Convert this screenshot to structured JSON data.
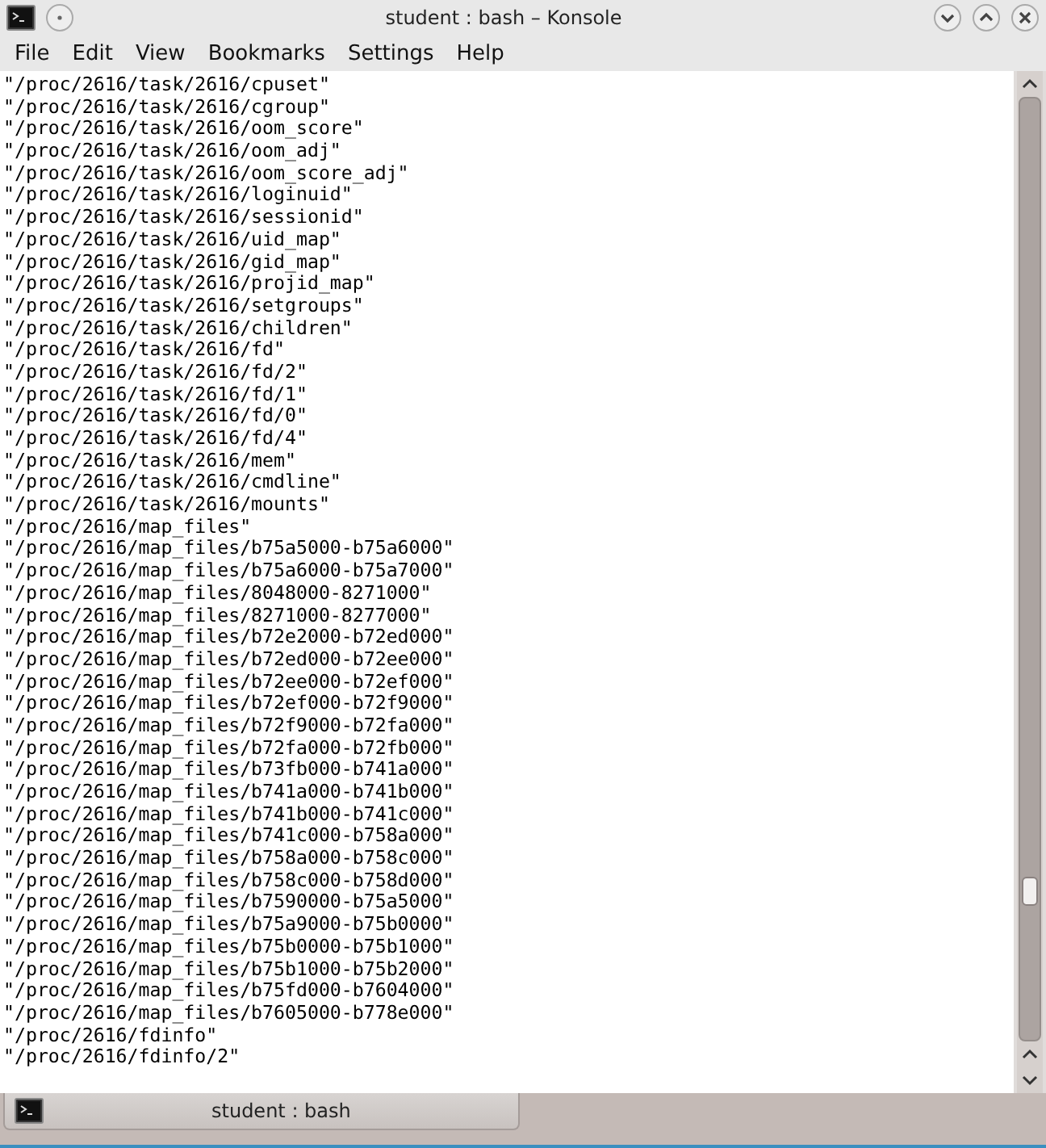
{
  "window": {
    "title": "student : bash – Konsole"
  },
  "menu": [
    "File",
    "Edit",
    "View",
    "Bookmarks",
    "Settings",
    "Help"
  ],
  "terminal": {
    "lines": [
      "\"/proc/2616/task/2616/cpuset\"",
      "\"/proc/2616/task/2616/cgroup\"",
      "\"/proc/2616/task/2616/oom_score\"",
      "\"/proc/2616/task/2616/oom_adj\"",
      "\"/proc/2616/task/2616/oom_score_adj\"",
      "\"/proc/2616/task/2616/loginuid\"",
      "\"/proc/2616/task/2616/sessionid\"",
      "\"/proc/2616/task/2616/uid_map\"",
      "\"/proc/2616/task/2616/gid_map\"",
      "\"/proc/2616/task/2616/projid_map\"",
      "\"/proc/2616/task/2616/setgroups\"",
      "\"/proc/2616/task/2616/children\"",
      "\"/proc/2616/task/2616/fd\"",
      "\"/proc/2616/task/2616/fd/2\"",
      "\"/proc/2616/task/2616/fd/1\"",
      "\"/proc/2616/task/2616/fd/0\"",
      "\"/proc/2616/task/2616/fd/4\"",
      "\"/proc/2616/task/2616/mem\"",
      "\"/proc/2616/task/2616/cmdline\"",
      "\"/proc/2616/task/2616/mounts\"",
      "\"/proc/2616/map_files\"",
      "\"/proc/2616/map_files/b75a5000-b75a6000\"",
      "\"/proc/2616/map_files/b75a6000-b75a7000\"",
      "\"/proc/2616/map_files/8048000-8271000\"",
      "\"/proc/2616/map_files/8271000-8277000\"",
      "\"/proc/2616/map_files/b72e2000-b72ed000\"",
      "\"/proc/2616/map_files/b72ed000-b72ee000\"",
      "\"/proc/2616/map_files/b72ee000-b72ef000\"",
      "\"/proc/2616/map_files/b72ef000-b72f9000\"",
      "\"/proc/2616/map_files/b72f9000-b72fa000\"",
      "\"/proc/2616/map_files/b72fa000-b72fb000\"",
      "\"/proc/2616/map_files/b73fb000-b741a000\"",
      "\"/proc/2616/map_files/b741a000-b741b000\"",
      "\"/proc/2616/map_files/b741b000-b741c000\"",
      "\"/proc/2616/map_files/b741c000-b758a000\"",
      "\"/proc/2616/map_files/b758a000-b758c000\"",
      "\"/proc/2616/map_files/b758c000-b758d000\"",
      "\"/proc/2616/map_files/b7590000-b75a5000\"",
      "\"/proc/2616/map_files/b75a9000-b75b0000\"",
      "\"/proc/2616/map_files/b75b0000-b75b1000\"",
      "\"/proc/2616/map_files/b75b1000-b75b2000\"",
      "\"/proc/2616/map_files/b75fd000-b7604000\"",
      "\"/proc/2616/map_files/b7605000-b778e000\"",
      "\"/proc/2616/fdinfo\"",
      "\"/proc/2616/fdinfo/2\""
    ]
  },
  "tabs": [
    {
      "label": "student : bash",
      "selected": true
    }
  ]
}
